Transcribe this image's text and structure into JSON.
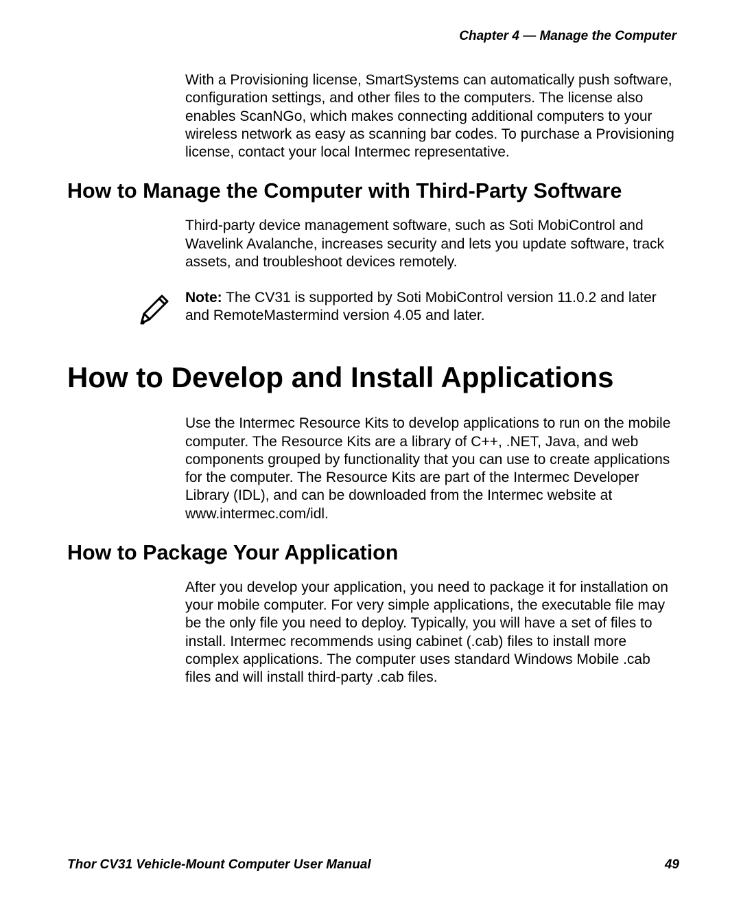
{
  "header": {
    "chapter_line": "Chapter 4 — Manage the Computer"
  },
  "intro": {
    "paragraph": "With a Provisioning license, SmartSystems can automatically push software, configuration settings, and other files to the computers. The license also enables ScanNGo, which makes connecting additional computers to your wireless network as easy as scanning bar codes. To purchase a Provisioning license, contact your local Intermec representative."
  },
  "section_third_party": {
    "heading": "How to Manage the Computer with Third-Party Software",
    "paragraph": "Third-party device management software, such as Soti MobiControl and Wavelink Avalanche, increases security and lets you update software, track assets, and troubleshoot devices remotely.",
    "note_label": "Note:",
    "note_text": " The CV31 is supported by Soti MobiControl version 11.0.2 and later and RemoteMastermind version 4.05 and later."
  },
  "section_develop": {
    "heading": "How to Develop and Install Applications",
    "paragraph": "Use the Intermec Resource Kits to develop applications to run on the mobile computer. The Resource Kits are a library of C++, .NET, Java, and web components grouped by functionality that you can use to create applications for the computer. The Resource Kits are part of the Intermec Developer Library (IDL), and can be downloaded from the Intermec website at www.intermec.com/idl."
  },
  "section_package": {
    "heading": "How to Package Your Application",
    "paragraph": "After you develop your application, you need to package it for installation on your mobile computer. For very simple applications, the executable file may be the only file you need to deploy. Typically, you will have a set of files to install. Intermec recommends using cabinet (.cab) files to install more complex applications. The computer uses standard Windows Mobile .cab files and will install third-party .cab files."
  },
  "footer": {
    "manual_title": "Thor CV31 Vehicle-Mount Computer User Manual",
    "page_number": "49"
  }
}
